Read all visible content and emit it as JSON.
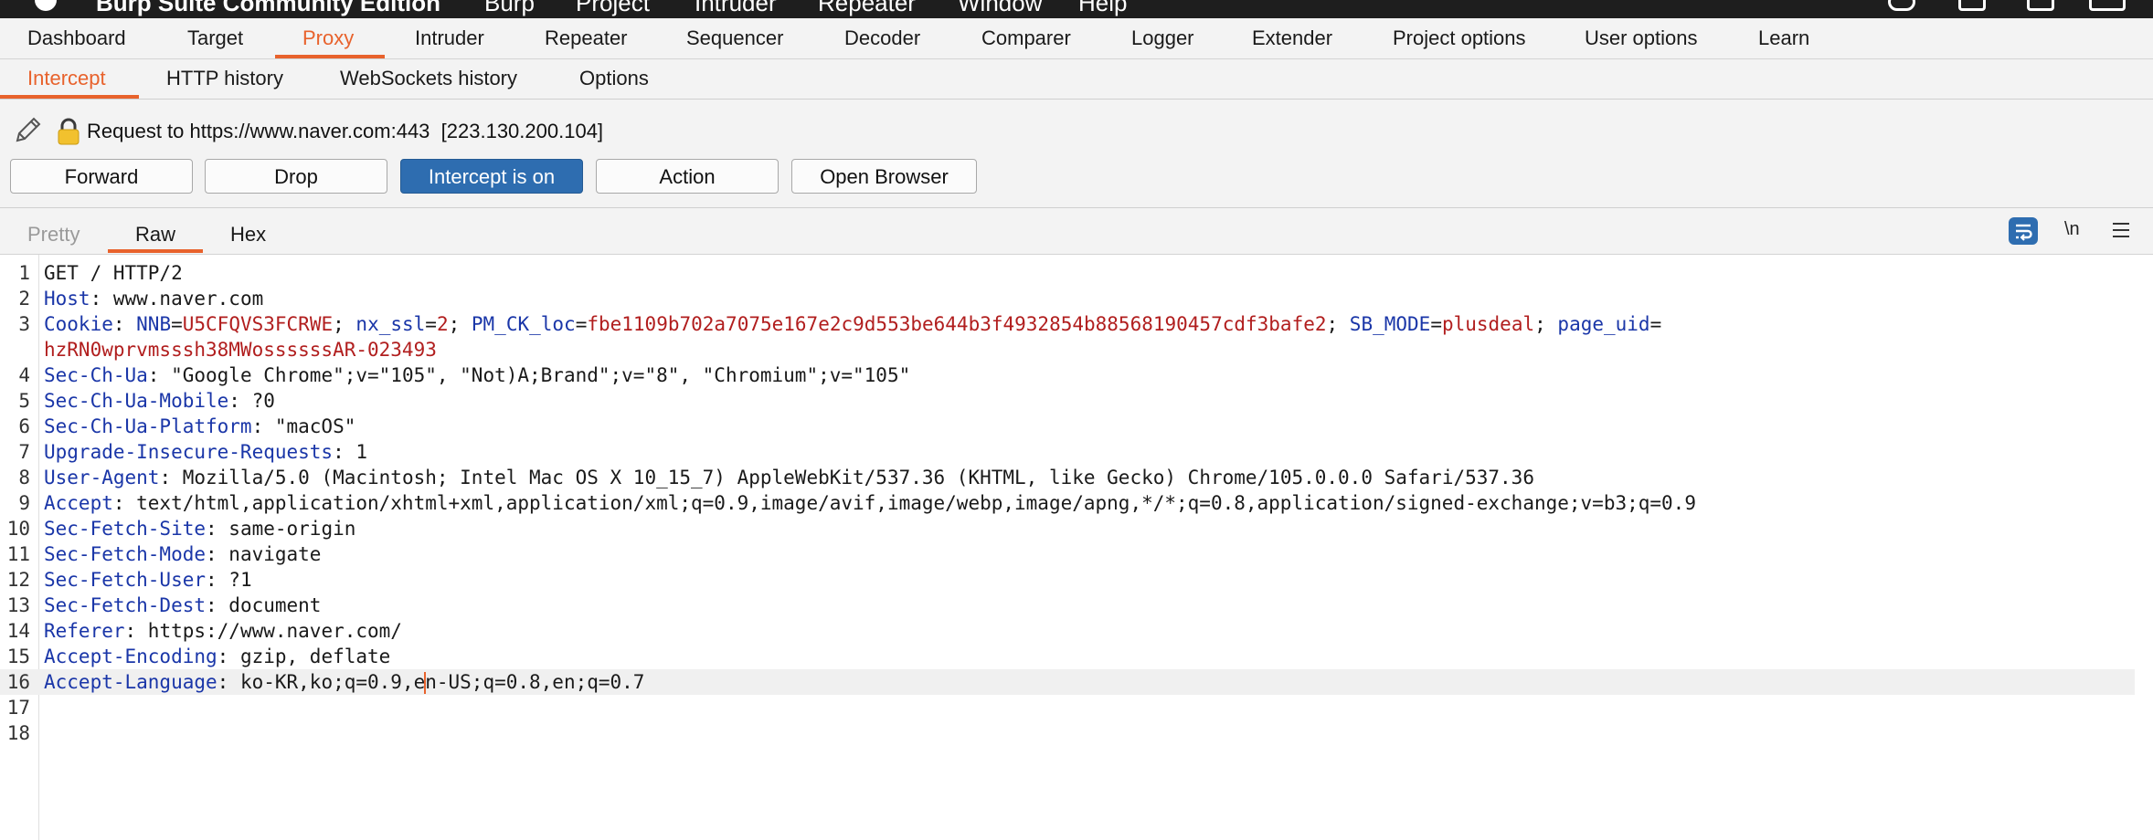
{
  "menubar": {
    "app_name": "Burp Suite Community Edition",
    "items": [
      "Burp",
      "Project",
      "Intruder",
      "Repeater",
      "Window",
      "Help"
    ]
  },
  "tabs": [
    "Dashboard",
    "Target",
    "Proxy",
    "Intruder",
    "Repeater",
    "Sequencer",
    "Decoder",
    "Comparer",
    "Logger",
    "Extender",
    "Project options",
    "User options",
    "Learn"
  ],
  "active_tab": "Proxy",
  "subtabs": [
    "Intercept",
    "HTTP history",
    "WebSockets history",
    "Options"
  ],
  "active_subtab": "Intercept",
  "intercept": {
    "request_label": "Request to https://www.naver.com:443",
    "ip": "[223.130.200.104]"
  },
  "buttons": {
    "forward": "Forward",
    "drop": "Drop",
    "intercept_toggle": "Intercept is on",
    "action": "Action",
    "open_browser": "Open Browser"
  },
  "editor": {
    "tabs": [
      "Pretty",
      "Raw",
      "Hex"
    ],
    "active_tab": "Raw",
    "newline_toggle": "\\n",
    "current_line": 16,
    "lines": [
      {
        "n": "1",
        "segs": [
          [
            "t",
            "GET / HTTP/2"
          ]
        ]
      },
      {
        "n": "2",
        "segs": [
          [
            "k",
            "Host"
          ],
          [
            "t",
            ": www.naver.com"
          ]
        ]
      },
      {
        "n": "3",
        "segs": [
          [
            "k",
            "Cookie"
          ],
          [
            "t",
            ": "
          ],
          [
            "k",
            "NNB"
          ],
          [
            "t",
            "="
          ],
          [
            "v",
            "U5CFQVS3FCRWE"
          ],
          [
            "t",
            "; "
          ],
          [
            "k",
            "nx_ssl"
          ],
          [
            "t",
            "="
          ],
          [
            "v",
            "2"
          ],
          [
            "t",
            "; "
          ],
          [
            "k",
            "PM_CK_loc"
          ],
          [
            "t",
            "="
          ],
          [
            "v",
            "fbe1109b702a7075e167e2c9d553be644b3f4932854b88568190457cdf3bafe2"
          ],
          [
            "t",
            "; "
          ],
          [
            "k",
            "SB_MODE"
          ],
          [
            "t",
            "="
          ],
          [
            "v",
            "plusdeal"
          ],
          [
            "t",
            "; "
          ],
          [
            "k",
            "page_uid"
          ],
          [
            "t",
            "="
          ]
        ]
      },
      {
        "n": "",
        "segs": [
          [
            "v",
            "hzRN0wprvmsssh38MWossssssAR-023493"
          ]
        ]
      },
      {
        "n": "4",
        "segs": [
          [
            "k",
            "Sec-Ch-Ua"
          ],
          [
            "t",
            ": \"Google Chrome\";v=\"105\", \"Not)A;Brand\";v=\"8\", \"Chromium\";v=\"105\""
          ]
        ]
      },
      {
        "n": "5",
        "segs": [
          [
            "k",
            "Sec-Ch-Ua-Mobile"
          ],
          [
            "t",
            ": ?0"
          ]
        ]
      },
      {
        "n": "6",
        "segs": [
          [
            "k",
            "Sec-Ch-Ua-Platform"
          ],
          [
            "t",
            ": \"macOS\""
          ]
        ]
      },
      {
        "n": "7",
        "segs": [
          [
            "k",
            "Upgrade-Insecure-Requests"
          ],
          [
            "t",
            ": 1"
          ]
        ]
      },
      {
        "n": "8",
        "segs": [
          [
            "k",
            "User-Agent"
          ],
          [
            "t",
            ": Mozilla/5.0 (Macintosh; Intel Mac OS X 10_15_7) AppleWebKit/537.36 (KHTML, like Gecko) Chrome/105.0.0.0 Safari/537.36"
          ]
        ]
      },
      {
        "n": "9",
        "segs": [
          [
            "k",
            "Accept"
          ],
          [
            "t",
            ": text/html,application/xhtml+xml,application/xml;q=0.9,image/avif,image/webp,image/apng,*/*;q=0.8,application/signed-exchange;v=b3;q=0.9"
          ]
        ]
      },
      {
        "n": "10",
        "segs": [
          [
            "k",
            "Sec-Fetch-Site"
          ],
          [
            "t",
            ": same-origin"
          ]
        ]
      },
      {
        "n": "11",
        "segs": [
          [
            "k",
            "Sec-Fetch-Mode"
          ],
          [
            "t",
            ": navigate"
          ]
        ]
      },
      {
        "n": "12",
        "segs": [
          [
            "k",
            "Sec-Fetch-User"
          ],
          [
            "t",
            ": ?1"
          ]
        ]
      },
      {
        "n": "13",
        "segs": [
          [
            "k",
            "Sec-Fetch-Dest"
          ],
          [
            "t",
            ": document"
          ]
        ]
      },
      {
        "n": "14",
        "segs": [
          [
            "k",
            "Referer"
          ],
          [
            "t",
            ": https://www.naver.com/"
          ]
        ]
      },
      {
        "n": "15",
        "segs": [
          [
            "k",
            "Accept-Encoding"
          ],
          [
            "t",
            ": gzip, deflate"
          ]
        ]
      },
      {
        "n": "16",
        "segs": [
          [
            "k",
            "Accept-Language"
          ],
          [
            "t",
            ": ko-KR,ko;q=0.9,e"
          ],
          [
            "c",
            ""
          ],
          [
            "t",
            "n-US;q=0.8,en;q=0.7"
          ]
        ]
      },
      {
        "n": "17",
        "segs": []
      },
      {
        "n": "18",
        "segs": []
      }
    ]
  },
  "colors": {
    "accent": "#e8622c",
    "primary_button": "#2e6db0",
    "header_key": "#1a36a8",
    "cookie_value": "#b11e1e"
  }
}
